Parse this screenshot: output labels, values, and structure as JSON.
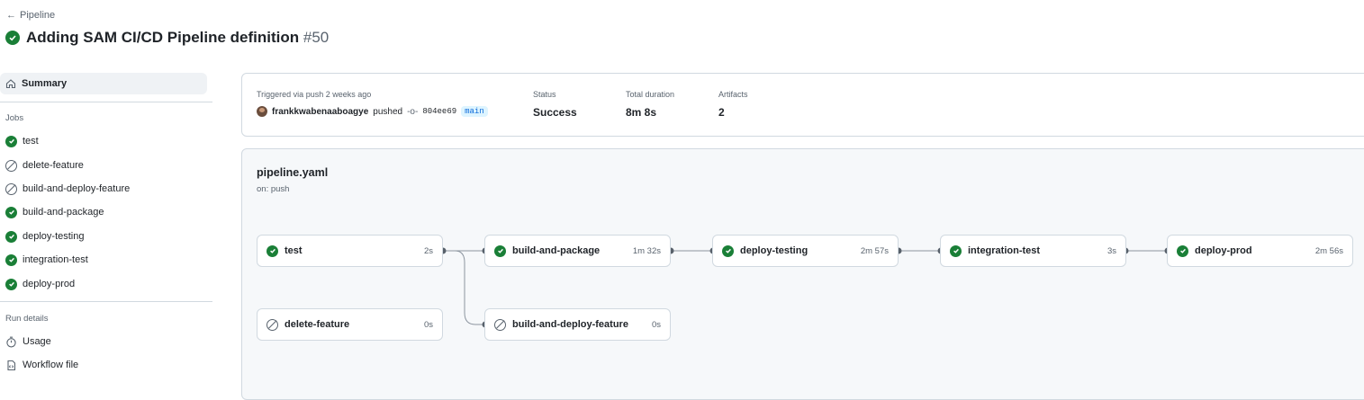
{
  "header": {
    "back_label": "Pipeline",
    "title": "Adding SAM CI/CD Pipeline definition",
    "run_number": "#50"
  },
  "sidebar": {
    "summary_label": "Summary",
    "jobs_heading": "Jobs",
    "jobs": [
      {
        "label": "test",
        "status": "success"
      },
      {
        "label": "delete-feature",
        "status": "skipped"
      },
      {
        "label": "build-and-deploy-feature",
        "status": "skipped"
      },
      {
        "label": "build-and-package",
        "status": "success"
      },
      {
        "label": "deploy-testing",
        "status": "success"
      },
      {
        "label": "integration-test",
        "status": "success"
      },
      {
        "label": "deploy-prod",
        "status": "success"
      }
    ],
    "run_details_heading": "Run details",
    "usage_label": "Usage",
    "workflow_file_label": "Workflow file"
  },
  "run_info": {
    "trigger_text": "Triggered via push 2 weeks ago",
    "actor": "frankkwabenaaboagye",
    "action": "pushed",
    "commit": "804ee69",
    "branch": "main",
    "status_label": "Status",
    "status_value": "Success",
    "duration_label": "Total duration",
    "duration_value": "8m 8s",
    "artifacts_label": "Artifacts",
    "artifacts_value": "2"
  },
  "workflow": {
    "file": "pipeline.yaml",
    "trigger": "on: push",
    "jobs": [
      {
        "name": "test",
        "duration": "2s",
        "status": "success"
      },
      {
        "name": "build-and-package",
        "duration": "1m 32s",
        "status": "success"
      },
      {
        "name": "deploy-testing",
        "duration": "2m 57s",
        "status": "success"
      },
      {
        "name": "integration-test",
        "duration": "3s",
        "status": "success"
      },
      {
        "name": "deploy-prod",
        "duration": "2m 56s",
        "status": "success"
      },
      {
        "name": "delete-feature",
        "duration": "0s",
        "status": "skipped"
      },
      {
        "name": "build-and-deploy-feature",
        "duration": "0s",
        "status": "skipped"
      }
    ]
  },
  "colors": {
    "success": "#1a7f37",
    "skipped": "#59636e",
    "border": "#d1d9e0",
    "branch_bg": "#ddf4ff",
    "branch_fg": "#0969da"
  }
}
